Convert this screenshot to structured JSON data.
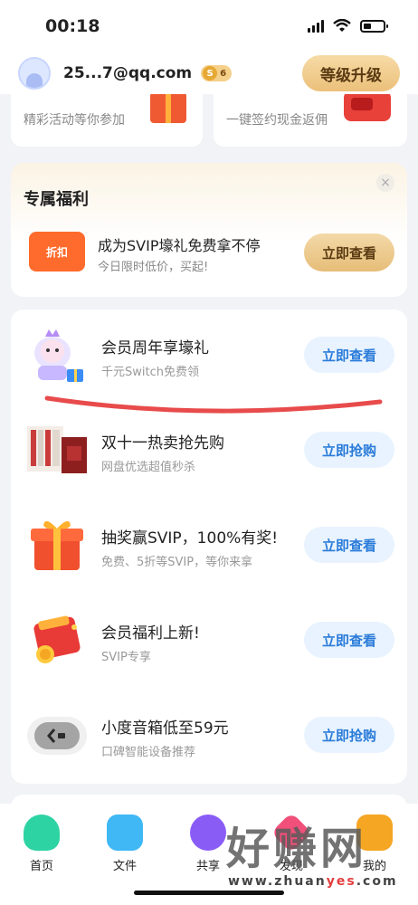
{
  "status_bar": {
    "time": "00:18"
  },
  "header": {
    "email": "25...7@qq.com",
    "vip_level_mark": "S",
    "vip_level_num": "6",
    "upgrade_label": "等级升级"
  },
  "top_cards": [
    {
      "subtitle": "精彩活动等你参加"
    },
    {
      "subtitle": "一键签约现金返佣"
    }
  ],
  "exclusive": {
    "title": "专属福利",
    "close_symbol": "×",
    "icon_label": "折扣",
    "main_text": "成为SVIP壕礼免费拿不停",
    "sub_text": "今日限时低价，买起!",
    "button": "立即查看"
  },
  "offers": [
    {
      "title": "会员周年享壕礼",
      "subtitle": "千元Switch免费领",
      "button": "立即查看",
      "thumb": "mascot-gift-icon"
    },
    {
      "title": "双十一热卖抢先购",
      "subtitle": "网盘优选超值秒杀",
      "button": "立即抢购",
      "thumb": "product-boxes-icon"
    },
    {
      "title": "抽奖赢SVIP，100%有奖!",
      "subtitle": "免费、5折等SVIP，等你来拿",
      "button": "立即查看",
      "thumb": "gift-box-icon"
    },
    {
      "title": "会员福利上新!",
      "subtitle": "SVIP专享",
      "button": "立即查看",
      "thumb": "red-envelope-icon"
    },
    {
      "title": "小度音箱低至59元",
      "subtitle": "口碑智能设备推荐",
      "button": "立即抢购",
      "thumb": "speaker-icon"
    }
  ],
  "tabs": [
    {
      "label": "首页",
      "icon": "home-icon",
      "color": "#2ed3a3"
    },
    {
      "label": "文件",
      "icon": "folder-icon",
      "color": "#3fb8f5"
    },
    {
      "label": "共享",
      "icon": "share-icon",
      "color": "#8a5cf6"
    },
    {
      "label": "发现",
      "icon": "discover-icon",
      "color": "#f0507a"
    },
    {
      "label": "我的",
      "icon": "profile-icon",
      "color": "#f5a623"
    }
  ],
  "watermark": {
    "text": "好赚网",
    "url_prefix": "www.zhuan",
    "url_highlight": "yes",
    "url_suffix": ".com"
  },
  "colors": {
    "accent_blue": "#2b7cd9",
    "gold": "#e6bd78",
    "annotation_red": "#e84b4b"
  }
}
